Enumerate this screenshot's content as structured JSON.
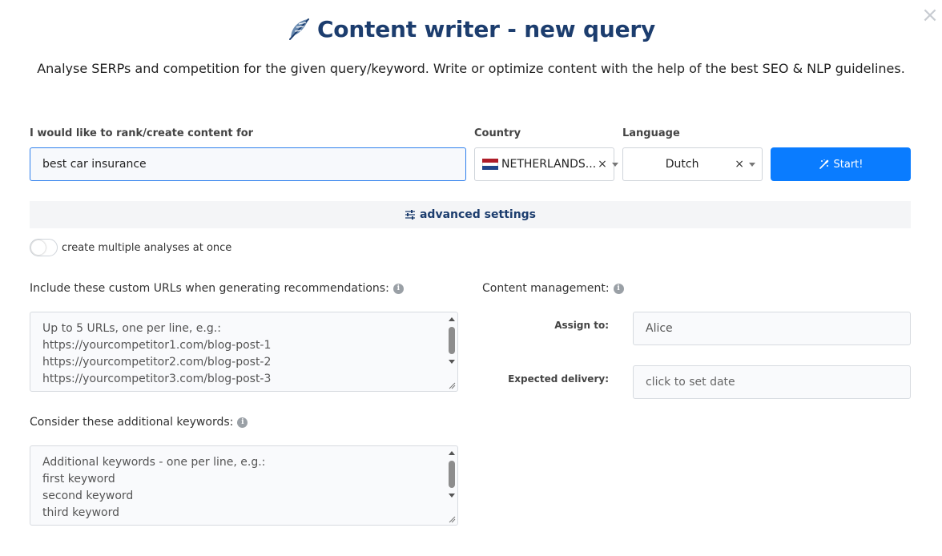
{
  "header": {
    "title": "Content writer - new query",
    "subtitle": "Analyse SERPs and competition for the given query/keyword. Write or optimize content with the help of the best SEO & NLP guidelines.",
    "close_icon": "×"
  },
  "query": {
    "label": "I would like to rank/create content for",
    "value": "best car insurance"
  },
  "country": {
    "label": "Country",
    "value": "NETHERLANDS...",
    "flag": "netherlands-flag",
    "flag_colors": [
      "#ae1c28",
      "#ffffff",
      "#21468b"
    ]
  },
  "language": {
    "label": "Language",
    "value": "Dutch"
  },
  "clear_symbol": "×",
  "start_button": {
    "label": "Start!",
    "icon": "magic-wand-icon",
    "color": "#0a7cff"
  },
  "advanced": {
    "label": "advanced settings",
    "icon": "sliders-icon"
  },
  "multiple": {
    "label": "create multiple analyses at once",
    "enabled": false
  },
  "custom_urls": {
    "label": "Include these custom URLs when generating recommendations:",
    "placeholder_lines": [
      "Up to 5 URLs, one per line, e.g.:",
      "https://yourcompetitor1.com/blog-post-1",
      "https://yourcompetitor2.com/blog-post-2",
      "https://yourcompetitor3.com/blog-post-3"
    ]
  },
  "additional_keywords": {
    "label": "Consider these additional keywords:",
    "placeholder_lines": [
      "Additional keywords - one per line, e.g.:",
      "first keyword",
      "second keyword",
      "third keyword"
    ]
  },
  "content_management": {
    "label": "Content management:",
    "assign_label": "Assign to:",
    "assign_value": "Alice",
    "delivery_label": "Expected delivery:",
    "delivery_placeholder": "click to set date"
  },
  "colors": {
    "title": "#1c3d6e",
    "accent": "#0a7cff",
    "input_border_focus": "#2f80ed"
  }
}
